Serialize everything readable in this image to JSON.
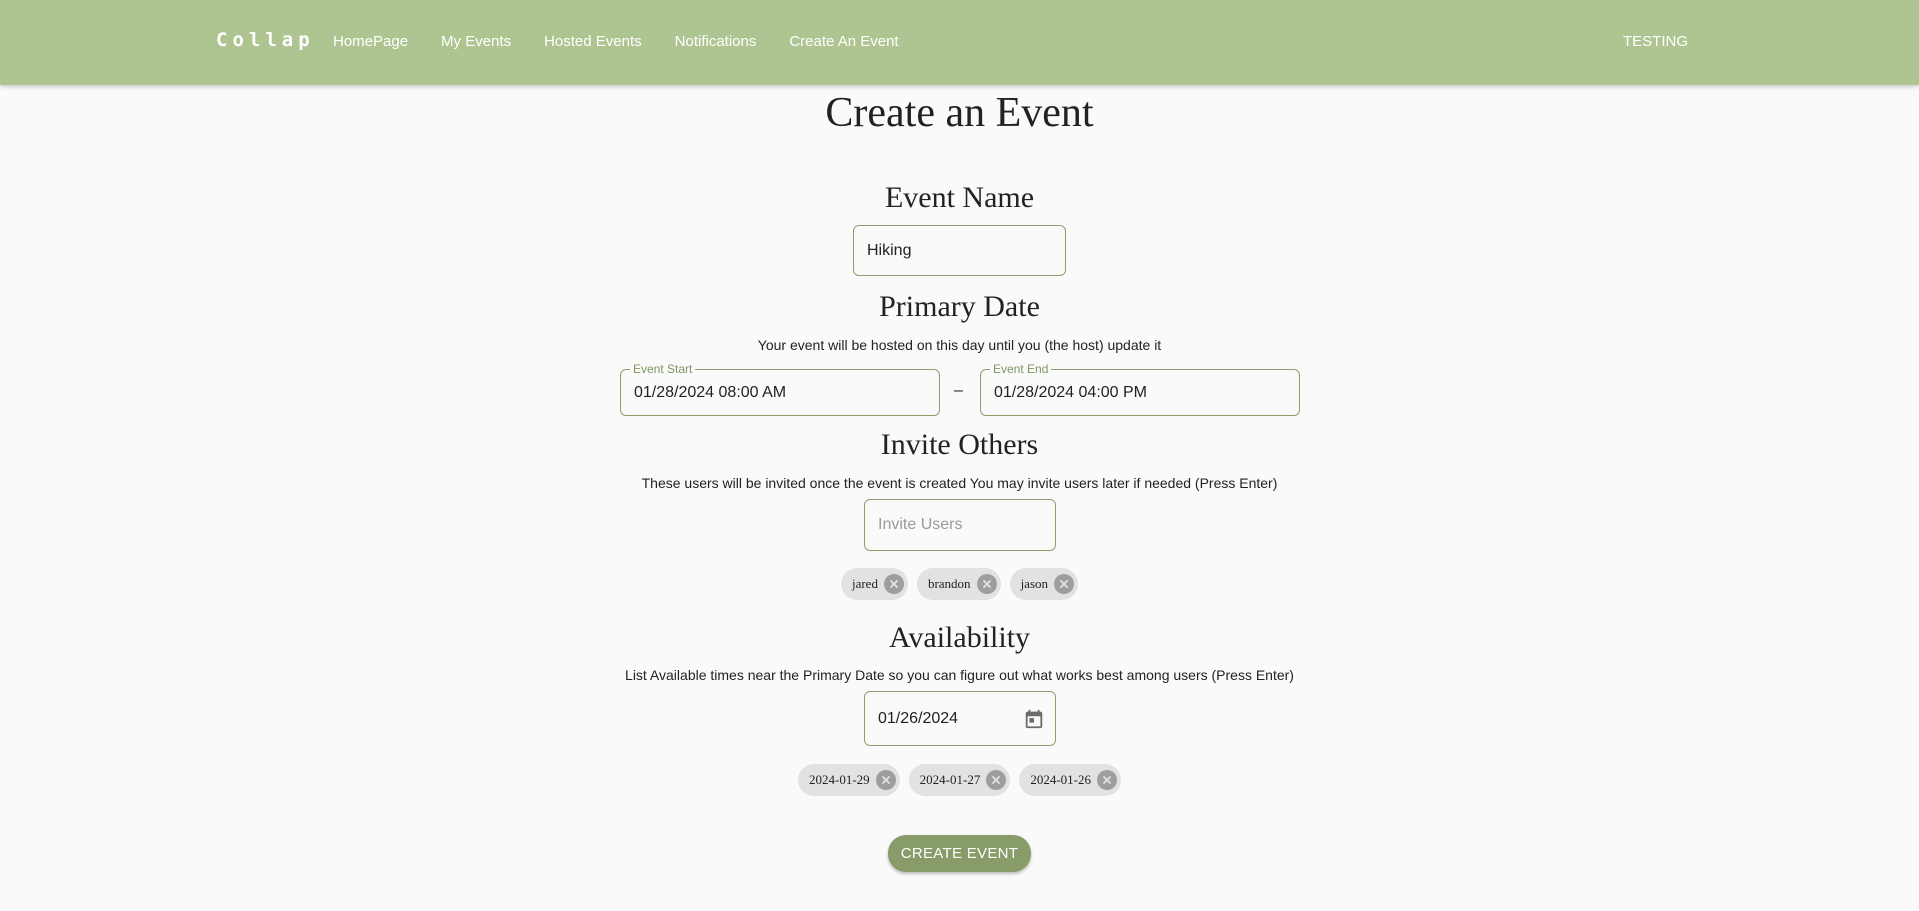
{
  "navbar": {
    "brand": "Collap",
    "links": [
      "HomePage",
      "My Events",
      "Hosted Events",
      "Notifications",
      "Create An Event"
    ],
    "user": "TESTING"
  },
  "page": {
    "title": "Create an Event"
  },
  "event_name": {
    "heading": "Event Name",
    "value": "Hiking"
  },
  "primary_date": {
    "heading": "Primary Date",
    "description": "Your event will be hosted on this day until you (the host) update it",
    "start_label": "Event Start",
    "start_value": "01/28/2024 08:00 AM",
    "separator": "–",
    "end_label": "Event End",
    "end_value": "01/28/2024 04:00 PM"
  },
  "invite": {
    "heading": "Invite Others",
    "description": "These users will be invited once the event is created You may invite users later if needed (Press Enter)",
    "placeholder": "Invite Users",
    "users": [
      "jared",
      "brandon",
      "jason"
    ]
  },
  "availability": {
    "heading": "Availability",
    "description": "List Available times near the Primary Date so you can figure out what works best among users (Press Enter)",
    "date_value": "01/26/2024",
    "dates": [
      "2024-01-29",
      "2024-01-27",
      "2024-01-26"
    ]
  },
  "actions": {
    "create_label": "CREATE EVENT"
  },
  "colors": {
    "appbar": "#afc591",
    "accent": "#879c69",
    "field_border": "#8e9f6d",
    "chip_bg": "#e2e2e2"
  },
  "icons": {
    "calendar": "calendar-icon",
    "chip_remove": "close-circle-icon"
  }
}
